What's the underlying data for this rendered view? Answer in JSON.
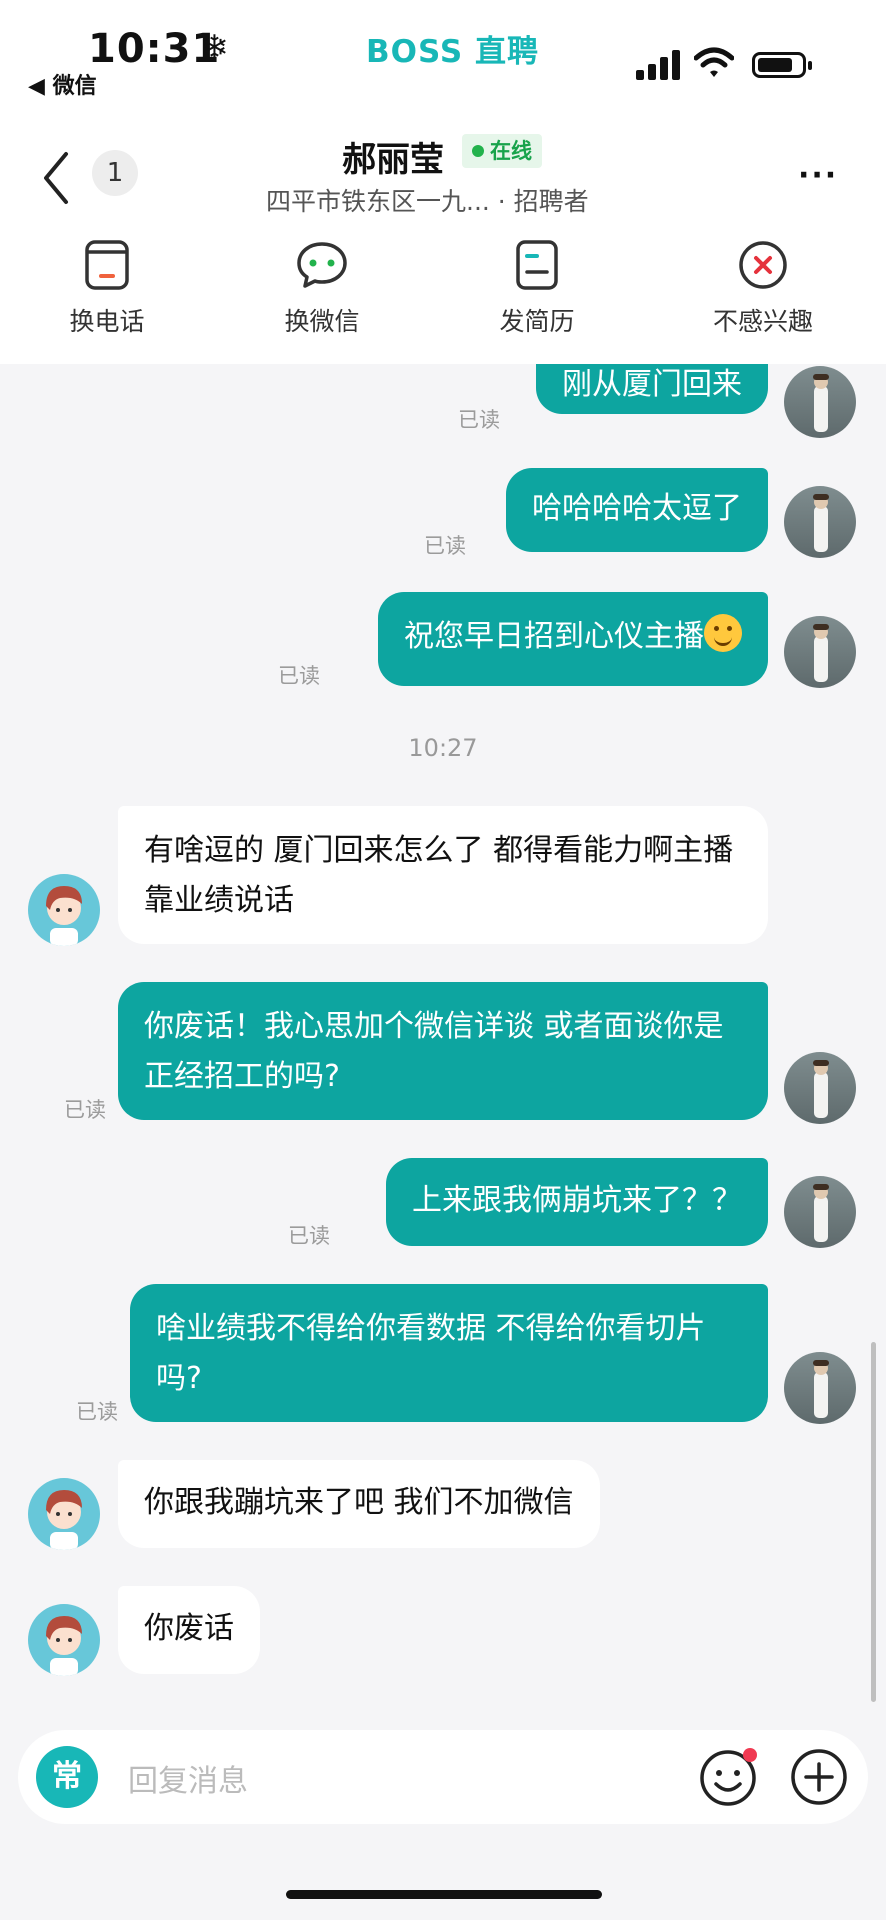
{
  "status": {
    "time": "10:31",
    "weather_glyph": "❄",
    "back_app": "◀ 微信",
    "brand": "BOSS 直聘"
  },
  "header": {
    "back_count": "1",
    "name": "郝丽莹",
    "online": "在线",
    "subtitle": "四平市铁东区一九...  · 招聘者",
    "more": "···",
    "actions": [
      {
        "label": "换电话",
        "icon": "phone-card-icon"
      },
      {
        "label": "换微信",
        "icon": "wechat-bubble-icon"
      },
      {
        "label": "发简历",
        "icon": "resume-icon"
      },
      {
        "label": "不感兴趣",
        "icon": "not-interested-icon"
      }
    ]
  },
  "chat": {
    "read_label": "已读",
    "timestamp": "10:27",
    "messages": [
      {
        "from": "me",
        "text": "刚从厦门回来"
      },
      {
        "from": "me",
        "text": "哈哈哈哈太逗了"
      },
      {
        "from": "me",
        "text": "祝您早日招到心仪主播"
      },
      {
        "from": "them",
        "text": "有啥逗的 厦门回来怎么了 都得看能力啊主播靠业绩说话"
      },
      {
        "from": "me",
        "text": "你废话！我心思加个微信详谈 或者面谈你是正经招工的吗?"
      },
      {
        "from": "me",
        "text": "上来跟我俩崩坑来了？？"
      },
      {
        "from": "me",
        "text": "啥业绩我不得给你看数据 不得给你看切片吗?"
      },
      {
        "from": "them",
        "text": "你跟我蹦坑来了吧 我们不加微信"
      },
      {
        "from": "them",
        "text": "你废话"
      }
    ]
  },
  "input": {
    "quick": "常",
    "placeholder": "回复消息"
  },
  "colors": {
    "accent": "#0da5a0",
    "brand": "#18b7b7",
    "online": "#22b24c",
    "badge": "#f03a52"
  }
}
